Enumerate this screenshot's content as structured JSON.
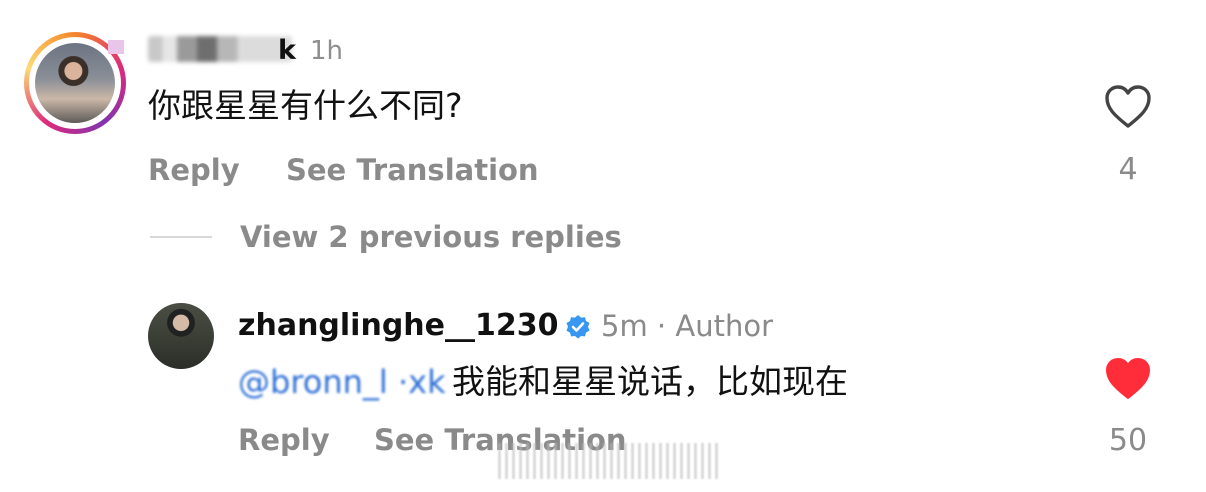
{
  "comment_1": {
    "username_visible": "k",
    "time": "1h",
    "text": "你跟星星有什么不同?",
    "reply_label": "Reply",
    "translate_label": "See Translation",
    "like_count": "4",
    "liked": false
  },
  "thread": {
    "view_previous_label": "View 2 previous replies"
  },
  "comment_2": {
    "username": "zhanglinghe__1230",
    "verified": true,
    "meta": "5m · Author",
    "mention": "@bronn_l ·xk",
    "text": "我能和星星说话，比如现在",
    "reply_label": "Reply",
    "translate_label": "See Translation",
    "like_count": "50",
    "liked": true
  },
  "colors": {
    "heart_liked": "#ff2d3a",
    "muted_text": "#8a8a8a",
    "verified_blue": "#3897f0",
    "mention_blue": "#2e6fd6"
  },
  "icons": {
    "like_1": "heart-outline-icon",
    "like_2": "heart-filled-icon",
    "verified": "verified-badge-icon"
  }
}
